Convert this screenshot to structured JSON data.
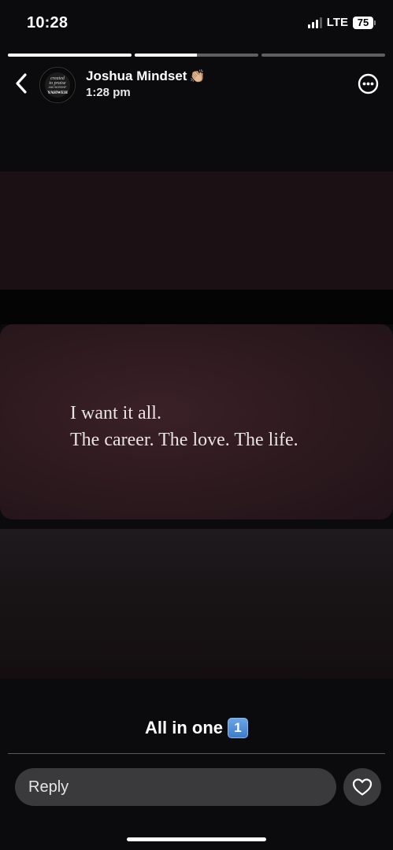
{
  "status_bar": {
    "time": "10:28",
    "network": "LTE",
    "battery": "75"
  },
  "story_progress": [
    1.0,
    0.5,
    0.0
  ],
  "header": {
    "user_name": "Joshua Mindset",
    "name_emoji": "👏🏼",
    "post_time": "1:28 pm",
    "avatar_text": {
      "line1": "created",
      "line2": "to praise",
      "line3": "AND WORSHIP",
      "line4": "YAHWEH"
    }
  },
  "story": {
    "quote_line1": "I want it all.",
    "quote_line2": "The career. The love. The life."
  },
  "caption": {
    "text": "All in one",
    "badge": "1"
  },
  "reply": {
    "placeholder": "Reply"
  },
  "icons": {
    "back": "chevron-left-icon",
    "more": "ellipsis-circle-icon",
    "like": "heart-icon"
  }
}
